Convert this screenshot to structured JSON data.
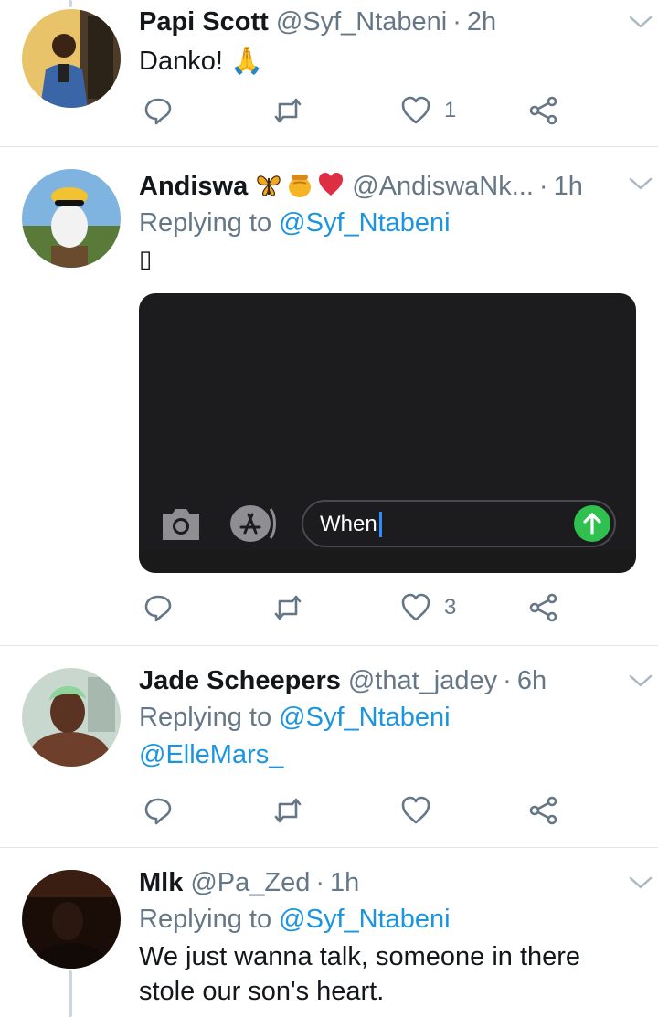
{
  "tweets": [
    {
      "name": "Papi Scott",
      "handle": "@Syf_Ntabeni",
      "time": "2h",
      "text": "Danko! 🙏",
      "likes": "1"
    },
    {
      "name": "Andiswa",
      "emojis": [
        "butterfly",
        "honey-pot",
        "red-heart"
      ],
      "handle": "@AndiswaNk...",
      "time": "1h",
      "replying_prefix": "Replying to",
      "replying_to": "@Syf_Ntabeni",
      "text": "▯",
      "media": {
        "message_text": "When"
      },
      "likes": "3"
    },
    {
      "name": "Jade Scheepers",
      "handle": "@that_jadey",
      "time": "6h",
      "replying_prefix": "Replying to",
      "replying_to": "@Syf_Ntabeni",
      "text": "@ElleMars_"
    },
    {
      "name": "Mlk",
      "handle": "@Pa_Zed",
      "time": "1h",
      "replying_prefix": "Replying to",
      "replying_to": "@Syf_Ntabeni",
      "text": "We just wanna talk, someone in there stole our son's heart."
    }
  ],
  "separator": "·",
  "colors": {
    "link": "#1b95e0",
    "secondary": "#657786",
    "send_button": "#30c04f",
    "divider": "#e1e8ed"
  }
}
